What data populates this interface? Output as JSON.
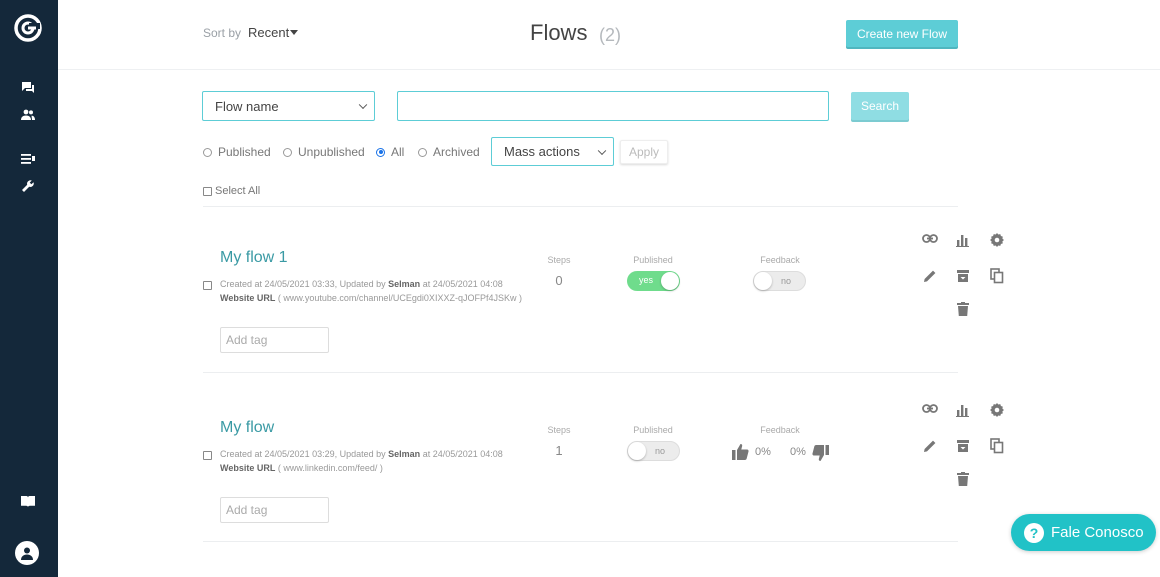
{
  "header": {
    "sort_label": "Sort by",
    "sort_value": "Recent",
    "title": "Flows",
    "count": "(2)",
    "create_button": "Create new Flow"
  },
  "filters": {
    "field_select": "Flow name",
    "search_value": "",
    "search_button": "Search",
    "radios": [
      {
        "label": "Published",
        "checked": false
      },
      {
        "label": "Unpublished",
        "checked": false
      },
      {
        "label": "All",
        "checked": true
      },
      {
        "label": "Archived",
        "checked": false
      }
    ],
    "mass_actions": "Mass actions",
    "apply_button": "Apply",
    "select_all": "Select All"
  },
  "columns": {
    "steps": "Steps",
    "published": "Published",
    "feedback": "Feedback"
  },
  "flows": [
    {
      "name": "My flow 1",
      "meta_prefix": "Created at 24/05/2021 03:33, Updated by",
      "meta_user": "Selman",
      "meta_suffix": "at 24/05/2021 04:08",
      "url_label": "Website URL",
      "url_value": "( www.youtube.com/channel/UCEgdi0XIXXZ-qJOFPf4JSKw )",
      "tag_placeholder": "Add tag",
      "steps": "0",
      "published": "yes",
      "feedback": "no"
    },
    {
      "name": "My flow",
      "meta_prefix": "Created at 24/05/2021 03:29, Updated by",
      "meta_user": "Selman",
      "meta_suffix": "at 24/05/2021 04:08",
      "url_label": "Website URL",
      "url_value": "( www.linkedin.com/feed/ )",
      "tag_placeholder": "Add tag",
      "steps": "1",
      "published": "no",
      "feedback_up": "0%",
      "feedback_down": "0%"
    }
  ],
  "chat_widget": {
    "label": "Fale Conosco",
    "icon_glyph": "?"
  },
  "colors": {
    "sidebar": "#14283a",
    "accent": "#5dcdd6",
    "toggle_on": "#6fdc8c",
    "chat": "#21c2c7"
  }
}
